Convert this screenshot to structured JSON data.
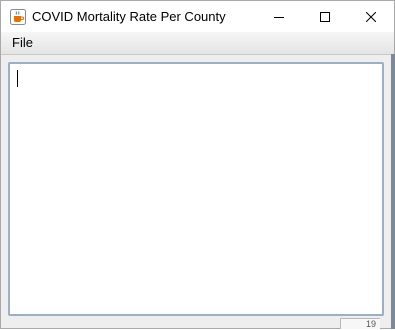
{
  "window": {
    "title": "COVID Mortality Rate Per County",
    "icon": "java-cup-icon",
    "controls": [
      "minimize-icon",
      "maximize-icon",
      "close-icon"
    ]
  },
  "menubar": {
    "items": [
      {
        "label": "File"
      }
    ]
  },
  "editor": {
    "value": ""
  },
  "background_peek": {
    "text": "19"
  }
}
